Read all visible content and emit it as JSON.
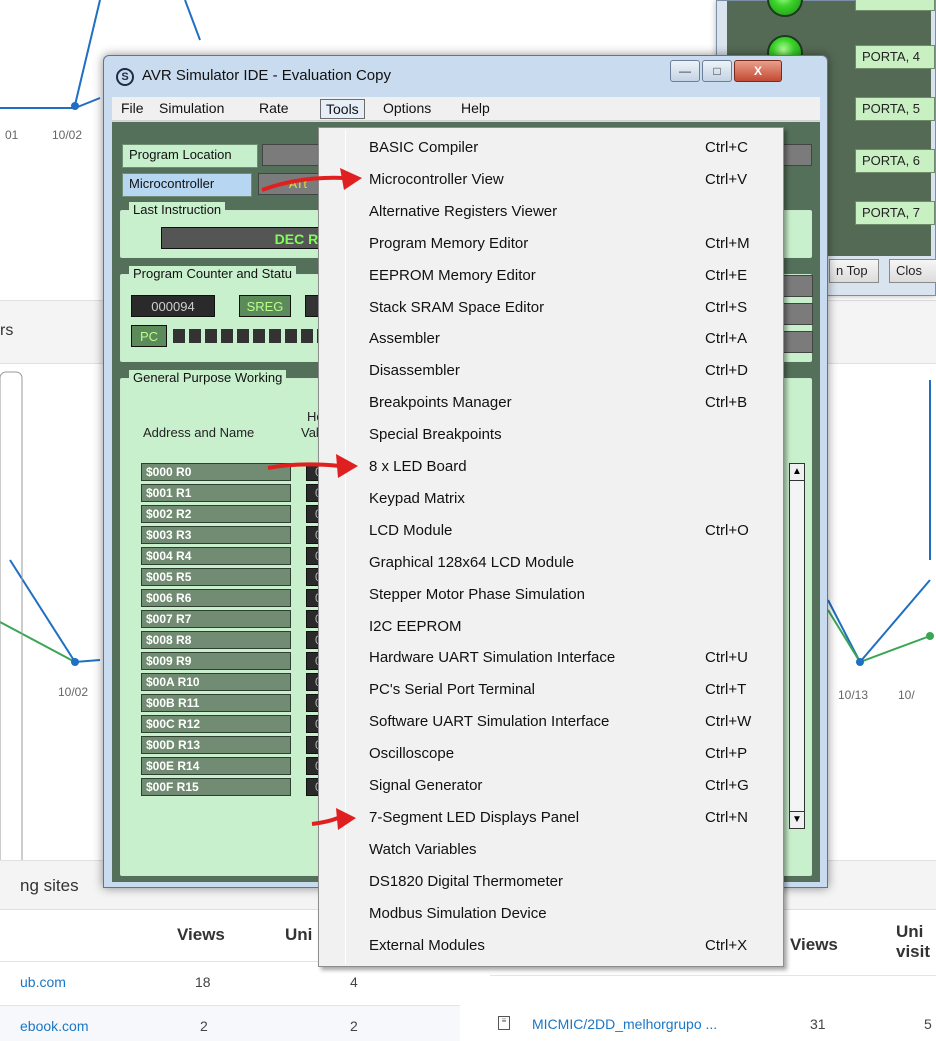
{
  "background": {
    "axis_labels": [
      "01",
      "10/02",
      "10/02",
      "10/13",
      "10/"
    ],
    "section_left_title": "rs",
    "sites_title": "ng sites",
    "table_left": {
      "headers": [
        "Views",
        "Uni"
      ],
      "rows": [
        {
          "site": "ub.com",
          "views": "18",
          "unique": "4"
        },
        {
          "site": "ebook.com",
          "views": "2",
          "unique": "2"
        }
      ]
    },
    "table_right": {
      "headers": [
        "Views",
        "Uni",
        "visit"
      ],
      "rows": [
        {
          "page": "MICMIC/2DD_melhorgrupo ...",
          "views": "31",
          "unique": "5"
        }
      ]
    }
  },
  "led_window": {
    "labels": [
      "PORTA, 4",
      "PORTA, 5",
      "PORTA, 6",
      "PORTA, 7"
    ],
    "on_top_label": "n Top",
    "close_label": "Clos"
  },
  "window": {
    "title": "AVR Simulator IDE - Evaluation Copy",
    "logo_glyph": "S",
    "controls": {
      "minimize": "—",
      "maximize": "□",
      "close": "X"
    },
    "menu": [
      "File",
      "Simulation",
      "Rate",
      "Tools",
      "Options",
      "Help"
    ],
    "active_menu": "Tools",
    "program_location_label": "Program Location",
    "microcontroller_label": "Microcontroller",
    "microcontroller_value": "ATt",
    "last_instruction_title": "Last Instruction",
    "last_instruction_value": "DEC R2",
    "pc_status_title": "Program Counter and Statu",
    "pc_value": "000094",
    "sreg_label": "SREG",
    "pc_label": "PC",
    "gpr_title": "General Purpose Working",
    "address_header": "Address and Name",
    "hex_header_1": "He",
    "hex_header_2": "Val",
    "registers": [
      {
        "name": "$000  R0",
        "val": "0"
      },
      {
        "name": "$001  R1",
        "val": "0"
      },
      {
        "name": "$002  R2",
        "val": "0"
      },
      {
        "name": "$003  R3",
        "val": "0"
      },
      {
        "name": "$004  R4",
        "val": "0"
      },
      {
        "name": "$005  R5",
        "val": "0"
      },
      {
        "name": "$006  R6",
        "val": "0"
      },
      {
        "name": "$007  R7",
        "val": "0"
      },
      {
        "name": "$008  R8",
        "val": "0"
      },
      {
        "name": "$009  R9",
        "val": "0"
      },
      {
        "name": "$00A  R10",
        "val": "0"
      },
      {
        "name": "$00B  R11",
        "val": "0"
      },
      {
        "name": "$00C  R12",
        "val": "0"
      },
      {
        "name": "$00D  R13",
        "val": "0"
      },
      {
        "name": "$00E  R14",
        "val": "0"
      },
      {
        "name": "$00F  R15",
        "val": "0"
      }
    ]
  },
  "tools_menu": [
    {
      "label": "BASIC Compiler",
      "shortcut": "Ctrl+C"
    },
    {
      "label": "Microcontroller View",
      "shortcut": "Ctrl+V"
    },
    {
      "label": "Alternative Registers Viewer",
      "shortcut": ""
    },
    {
      "label": "Program Memory Editor",
      "shortcut": "Ctrl+M"
    },
    {
      "label": "EEPROM Memory Editor",
      "shortcut": "Ctrl+E"
    },
    {
      "label": "Stack SRAM Space Editor",
      "shortcut": "Ctrl+S"
    },
    {
      "label": "Assembler",
      "shortcut": "Ctrl+A"
    },
    {
      "label": "Disassembler",
      "shortcut": "Ctrl+D"
    },
    {
      "label": "Breakpoints Manager",
      "shortcut": "Ctrl+B"
    },
    {
      "label": "Special Breakpoints",
      "shortcut": ""
    },
    {
      "label": "8 x LED Board",
      "shortcut": ""
    },
    {
      "label": "Keypad Matrix",
      "shortcut": ""
    },
    {
      "label": "LCD Module",
      "shortcut": "Ctrl+O"
    },
    {
      "label": "Graphical 128x64 LCD Module",
      "shortcut": ""
    },
    {
      "label": "Stepper Motor Phase Simulation",
      "shortcut": ""
    },
    {
      "label": "I2C EEPROM",
      "shortcut": ""
    },
    {
      "label": "Hardware UART Simulation Interface",
      "shortcut": "Ctrl+U"
    },
    {
      "label": "PC's Serial Port Terminal",
      "shortcut": "Ctrl+T"
    },
    {
      "label": "Software UART Simulation Interface",
      "shortcut": "Ctrl+W"
    },
    {
      "label": "Oscilloscope",
      "shortcut": "Ctrl+P"
    },
    {
      "label": "Signal Generator",
      "shortcut": "Ctrl+G"
    },
    {
      "label": "7-Segment LED Displays Panel",
      "shortcut": "Ctrl+N"
    },
    {
      "label": "Watch Variables",
      "shortcut": ""
    },
    {
      "label": "DS1820 Digital Thermometer",
      "shortcut": ""
    },
    {
      "label": "Modbus Simulation Device",
      "shortcut": ""
    },
    {
      "label": "External Modules",
      "shortcut": "Ctrl+X"
    }
  ],
  "colors": {
    "client_green": "#54705a",
    "label_green": "#c6f0cb",
    "chart_blue": "#1f6fc2",
    "chart_green": "#3aa655",
    "annotation_red": "#e02020"
  }
}
